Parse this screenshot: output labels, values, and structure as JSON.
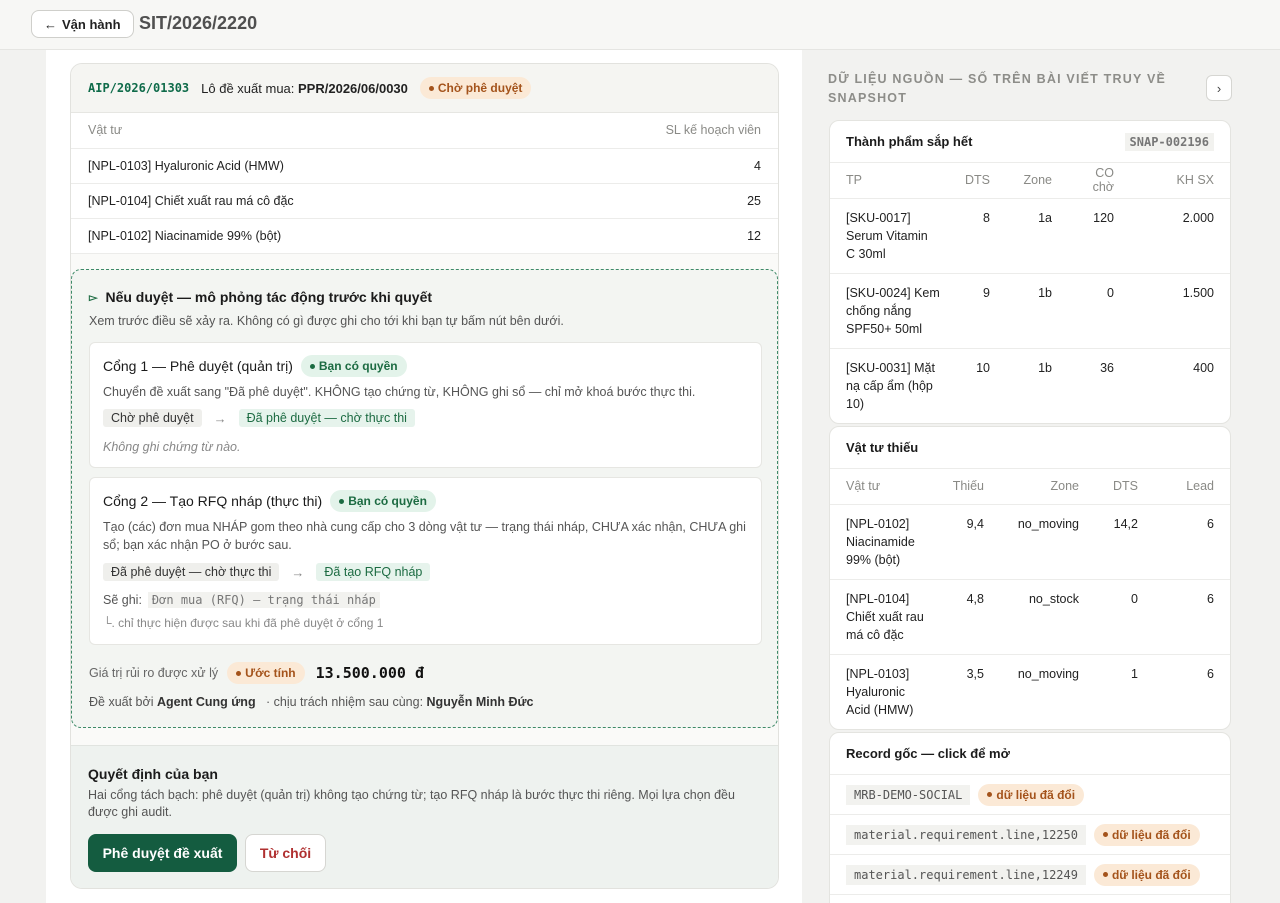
{
  "header": {
    "back_label": "Vận hành",
    "back_arrow": "←",
    "title": "SIT/2026/2220"
  },
  "proposal": {
    "code": "AIP/2026/01303",
    "lot_label": "Lô đề xuất mua:",
    "lot_value": "PPR/2026/06/0030",
    "status": "Chờ phê duyệt",
    "columns": {
      "material": "Vật tư",
      "qty": "SL kế hoạch viên"
    },
    "rows": [
      {
        "material": "[NPL-0103] Hyaluronic Acid (HMW)",
        "qty": "4"
      },
      {
        "material": "[NPL-0104] Chiết xuất rau má cô đặc",
        "qty": "25"
      },
      {
        "material": "[NPL-0102] Niacinamide 99% (bột)",
        "qty": "12"
      }
    ]
  },
  "simulation": {
    "title": "Nếu duyệt — mô phỏng tác động trước khi quyết",
    "description": "Xem trước điều sẽ xảy ra. Không có gì được ghi cho tới khi bạn tự bấm nút bên dưới.",
    "gate1": {
      "title": "Cổng 1 — Phê duyệt (quản trị)",
      "badge": "Bạn có quyền",
      "description": "Chuyển đề xuất sang \"Đã phê duyệt\". KHÔNG tạo chứng từ, KHÔNG ghi sổ — chỉ mở khoá bước thực thi.",
      "from": "Chờ phê duyệt",
      "to": "Đã phê duyệt — chờ thực thi",
      "note": "Không ghi chứng từ nào."
    },
    "gate2": {
      "title": "Cổng 2 — Tạo RFQ nháp (thực thi)",
      "badge": "Bạn có quyền",
      "description": "Tạo (các) đơn mua NHÁP gom theo nhà cung cấp cho 3 dòng vật tư — trạng thái nháp, CHƯA xác nhận, CHƯA ghi sổ; bạn xác nhận PO ở bước sau.",
      "from": "Đã phê duyệt — chờ thực thi",
      "to": "Đã tạo RFQ nháp",
      "will_write_label": "Sẽ ghi:",
      "will_write_value": "Đơn mua (RFQ) — trạng thái nháp",
      "sub_note": "└. chỉ thực hiện được sau khi đã phê duyệt ở cổng 1"
    },
    "risk_label": "Giá trị rủi ro được xử lý",
    "risk_badge": "Ước tính",
    "risk_amount": "13.500.000 đ",
    "proposed_by_label": "Đề xuất bởi",
    "proposed_by": "Agent Cung ứng",
    "responsible_label": "· chịu trách nhiệm sau cùng:",
    "responsible": "Nguyễn Minh Đức"
  },
  "decision": {
    "title": "Quyết định của bạn",
    "description": "Hai cổng tách bạch: phê duyệt (quản trị) không tạo chứng từ; tạo RFQ nháp là bước thực thi riêng. Mọi lựa chọn đều được ghi audit.",
    "approve_label": "Phê duyệt đề xuất",
    "reject_label": "Từ chối"
  },
  "side": {
    "title": "DỮ LIỆU NGUỒN — SỐ TRÊN BÀI VIẾT TRUY VỀ SNAPSHOT",
    "chevron": "›",
    "finished": {
      "title": "Thành phẩm sắp hết",
      "snapshot": "SNAP-002196",
      "columns": [
        "TP",
        "DTS",
        "Zone",
        "CO chờ",
        "KH SX"
      ],
      "rows": [
        [
          "[SKU-0017] Serum Vitamin C 30ml",
          "8",
          "1a",
          "120",
          "2.000"
        ],
        [
          "[SKU-0024] Kem chống nắng SPF50+ 50ml",
          "9",
          "1b",
          "0",
          "1.500"
        ],
        [
          "[SKU-0031] Mặt nạ cấp ẩm (hộp 10)",
          "10",
          "1b",
          "36",
          "400"
        ]
      ]
    },
    "shortage": {
      "title": "Vật tư thiếu",
      "columns": [
        "Vật tư",
        "Thiếu",
        "Zone",
        "DTS",
        "Lead"
      ],
      "rows": [
        [
          "[NPL-0102] Niacinamide 99% (bột)",
          "9,4",
          "no_moving",
          "14,2",
          "6"
        ],
        [
          "[NPL-0104] Chiết xuất rau má cô đặc",
          "4,8",
          "no_stock",
          "0",
          "6"
        ],
        [
          "[NPL-0103] Hyaluronic Acid (HMW)",
          "3,5",
          "no_moving",
          "1",
          "6"
        ]
      ]
    },
    "records": {
      "title": "Record gốc — click để mở",
      "items": [
        {
          "code": "MRB-DEMO-SOCIAL",
          "badge": "dữ liệu đã đổi"
        },
        {
          "code": "material.requirement.line,12250",
          "badge": "dữ liệu đã đổi"
        },
        {
          "code": "material.requirement.line,12249",
          "badge": "dữ liệu đã đổi"
        }
      ]
    }
  }
}
